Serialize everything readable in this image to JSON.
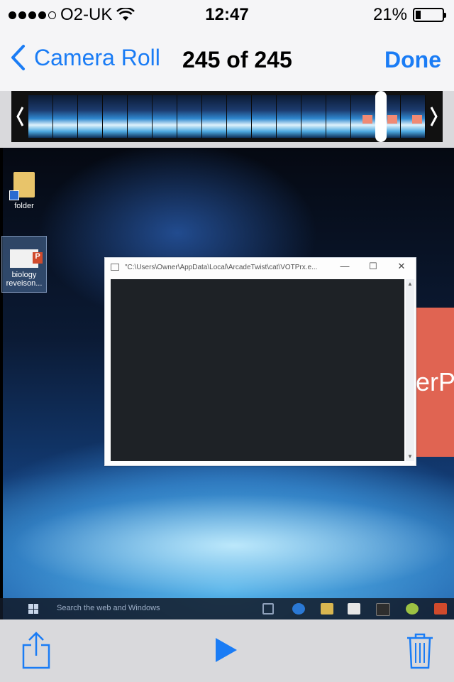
{
  "status_bar": {
    "carrier": "O2-UK",
    "time": "12:47",
    "battery_text": "21%",
    "battery_level": 0.21,
    "signal_bars": 4
  },
  "nav": {
    "back_label": "Camera Roll",
    "title": "245 of 245",
    "done_label": "Done"
  },
  "colors": {
    "accent": "#1a7cf5",
    "bar_background": "#f5f5f7",
    "toolbar_background": "#d9d9dc"
  },
  "scrubber": {
    "frame_count": 16
  },
  "photo": {
    "desktop_icons": [
      {
        "label": "folder"
      },
      {
        "label": "biology reveison..."
      }
    ],
    "window_title": "\"C:\\Users\\Owner\\AppData\\Local\\ArcadeTwist\\cat\\VOTPrx.e...",
    "partial_text": "erPo",
    "taskbar_search": "Search the web and Windows"
  },
  "toolbar": {
    "share_icon": "share-icon",
    "play_icon": "play-icon",
    "trash_icon": "trash-icon"
  }
}
